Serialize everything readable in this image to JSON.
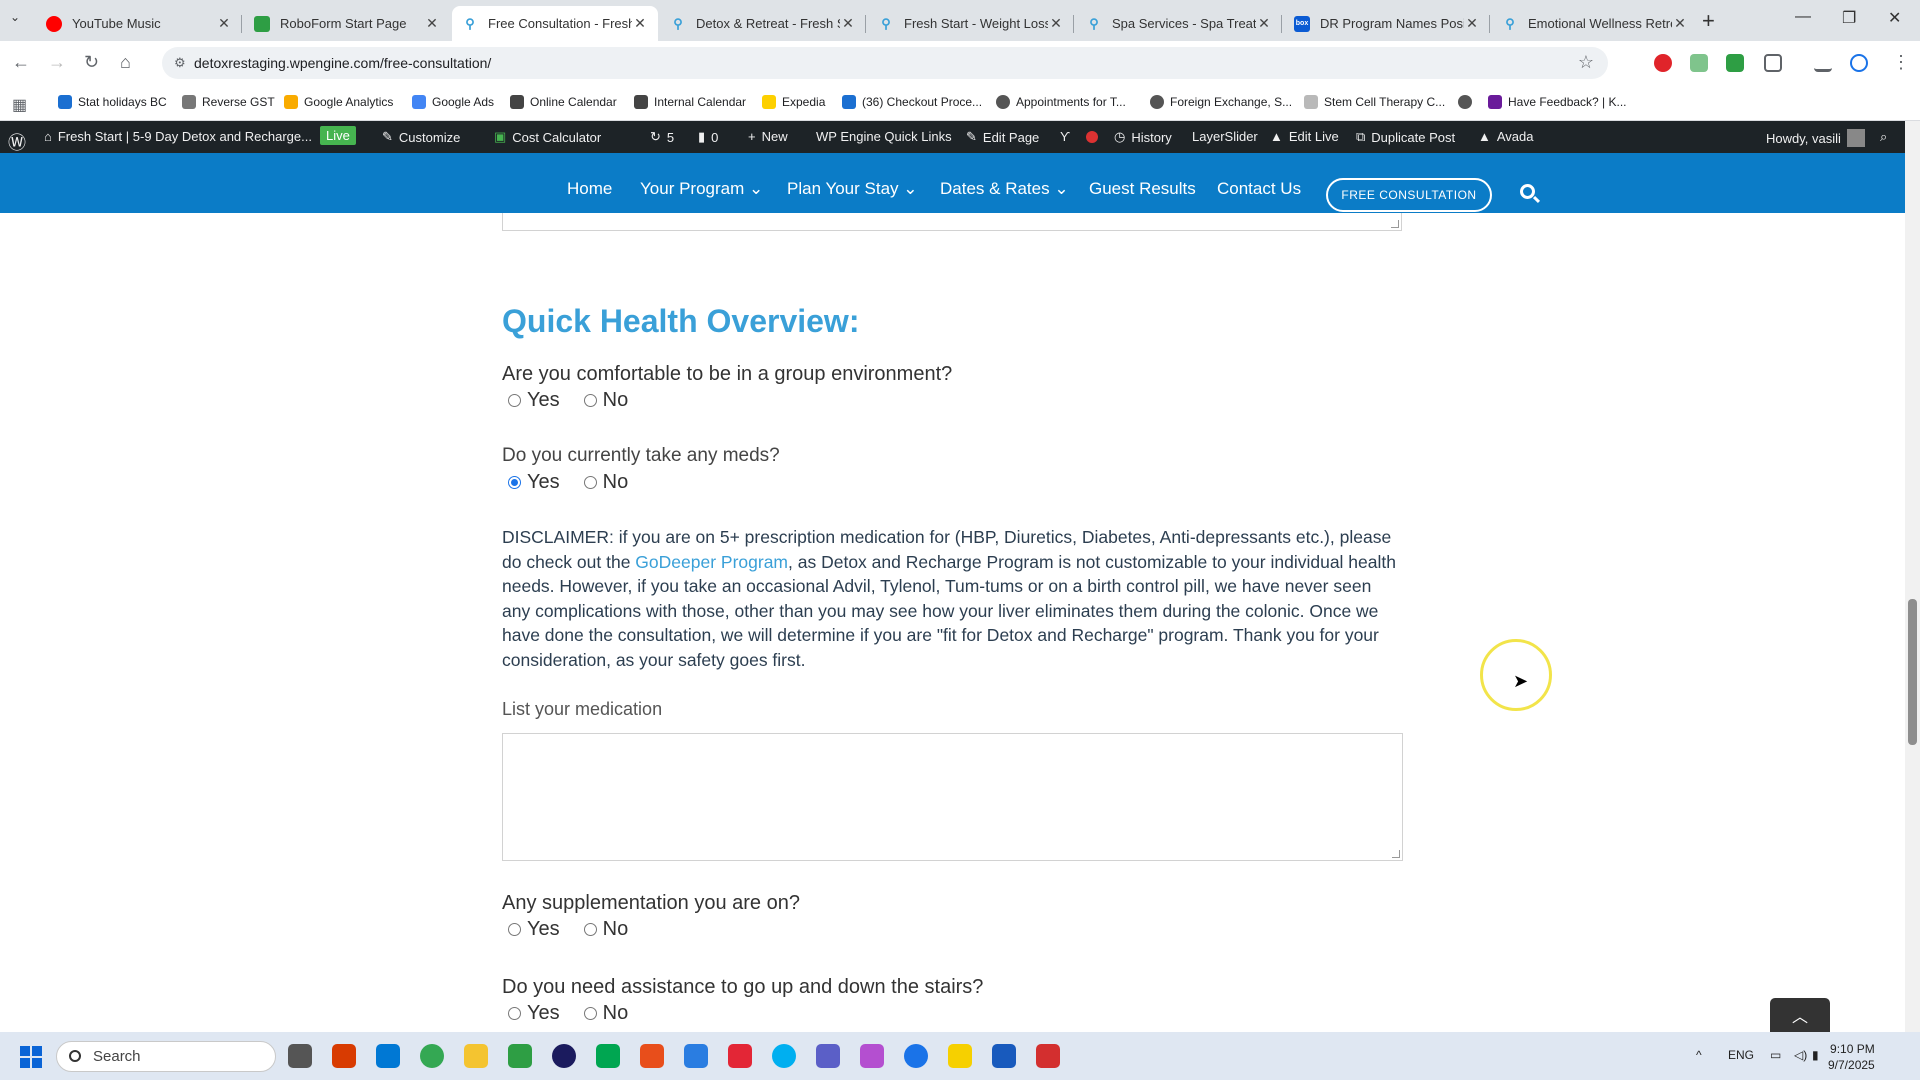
{
  "browser": {
    "tabs": [
      {
        "title": "YouTube Music",
        "color": "#ff0000"
      },
      {
        "title": "RoboForm Start Page",
        "color": "#2e9e44"
      },
      {
        "title": "Free Consultation - Fresh",
        "color": "#3aa0d8",
        "active": true
      },
      {
        "title": "Detox & Retreat - Fresh S",
        "color": "#3aa0d8"
      },
      {
        "title": "Fresh Start - Weight Loss",
        "color": "#3aa0d8"
      },
      {
        "title": "Spa Services - Spa Treatm",
        "color": "#3aa0d8"
      },
      {
        "title": "DR Program Names Posit",
        "color": "#0b5bd3"
      },
      {
        "title": "Emotional Wellness Retre",
        "color": "#3aa0d8"
      }
    ],
    "url": "detoxrestaging.wpengine.com/free-consultation/",
    "bookmarks": [
      "Stat holidays BC",
      "Reverse GST",
      "Google Analytics",
      "Google Ads",
      "Online Calendar",
      "Internal Calendar",
      "Expedia",
      "(36) Checkout Proce...",
      "Appointments for T...",
      "Foreign Exchange, S...",
      "Stem Cell Therapy C...",
      "",
      "Have Feedback? | K..."
    ]
  },
  "wpbar": {
    "site": "Fresh Start | 5-9 Day Detox and Recharge...",
    "live": "Live",
    "customize": "Customize",
    "cost_calculator": "Cost Calculator",
    "updates": "5",
    "comments": "0",
    "new": "New",
    "wpengine": "WP Engine Quick Links",
    "edit_page": "Edit Page",
    "history": "History",
    "layerslider": "LayerSlider",
    "edit_live": "Edit Live",
    "duplicate": "Duplicate Post",
    "avada": "Avada",
    "howdy": "Howdy, vasili"
  },
  "nav": {
    "home": "Home",
    "program": "Your Program",
    "plan": "Plan Your Stay",
    "dates": "Dates & Rates",
    "results": "Guest Results",
    "contact": "Contact Us",
    "cta": "FREE CONSULTATION"
  },
  "form": {
    "section_title": "Quick Health Overview:",
    "q1": "Are you comfortable to be in a group environment?",
    "q2": "Do you currently take any meds?",
    "q3": "Any supplementation you are on?",
    "q4": "Do you need assistance to go up and down the stairs?",
    "yes": "Yes",
    "no": "No",
    "q2_selected": "Yes",
    "disclaimer_1": "DISCLAIMER: if you are on 5+ prescription medication for (HBP, Diuretics, Diabetes, Anti-depressants etc.), please do check out the ",
    "disclaimer_link": "GoDeeper Program",
    "disclaimer_2": ", as Detox and Recharge Program is not customizable to your individual health needs. However, if you take an occasional Advil, Tylenol, Tum-tums or on a birth control pill, we have never seen any complications with those, other than you may see how your liver eliminates them during the colonic. Once we have done the consultation, we will determine if you are \"fit for Detox and Recharge\" program. Thank you for your consideration, as your safety goes first.",
    "medication_label": "List your medication"
  },
  "taskbar": {
    "search": "Search",
    "lang": "ENG",
    "time": "9:10 PM",
    "date": "9/7/2025"
  }
}
